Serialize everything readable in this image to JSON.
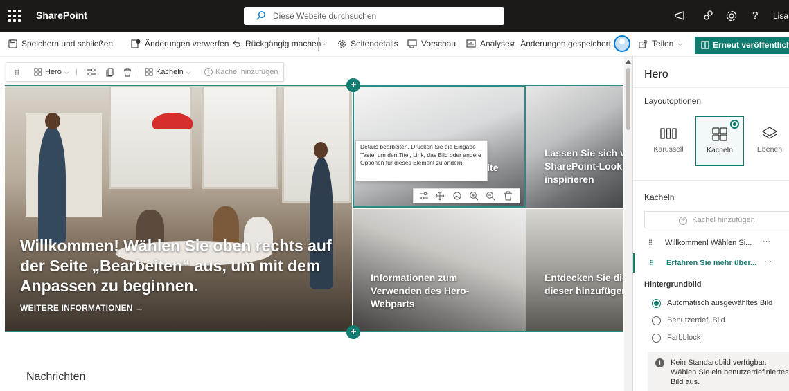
{
  "suite": {
    "app_name": "SharePoint",
    "search_placeholder": "Diese Website durchsuchen",
    "user_name": "Lisa",
    "help_label": "?"
  },
  "commandbar": {
    "save_close": "Speichern und schließen",
    "discard": "Änderungen verwerfen",
    "undo": "Rückgängig machen",
    "page_details": "Seitendetails",
    "preview": "Vorschau",
    "analytics": "Analysen",
    "saved_status": "Änderungen gespeichert",
    "share": "Teilen",
    "republish": "Erneut veröffentliche"
  },
  "webpart_toolbar": {
    "webpart_name": "Hero",
    "layout": "Kacheln",
    "add_tile": "Kachel hinzufügen"
  },
  "hero": {
    "main_title": "Willkommen! Wählen Sie oben rechts auf der Seite „Bearbeiten“ aus, um mit dem Anpassen zu beginnen.",
    "main_link": "WEITERE INFORMATIONEN →",
    "tile2_title": "Ihre Kommunikationswebsite",
    "tile3_title": "Lassen Sie sich von SharePoint-Look inspirieren",
    "tile4_title": "Informationen zum Verwenden des Hero-Webparts",
    "tile5_title": "Entdecken Sie die Sie zu dieser hinzufügen kön"
  },
  "tooltip": {
    "text": "Details bearbeiten. Drücken Sie die Eingabe Taste, um den Titel, Link, das Bild oder andere Optionen für dieses Element zu ändern."
  },
  "news_heading": "Nachrichten",
  "panel": {
    "title": "Hero",
    "layout_options_label": "Layoutoptionen",
    "layouts": [
      "Karussell",
      "Kacheln",
      "Ebenen"
    ],
    "selected_layout": "Kacheln",
    "tiles_label": "Kacheln",
    "add_tile": "Kachel hinzufügen",
    "tile_items": [
      "Willkommen! Wählen Si...",
      "Erfahren Sie mehr über..."
    ],
    "more_label": "···",
    "background_label": "Hintergrundbild",
    "background_options": [
      "Automatisch ausgewähltes Bild",
      "Benutzerdef. Bild",
      "Farbblock"
    ],
    "notice": "Kein Standardbild verfügbar. Wählen Sie ein benutzerdefiniertes Bild aus."
  },
  "colors": {
    "accent": "#107c6f",
    "suite_bar": "#1b1a19"
  }
}
